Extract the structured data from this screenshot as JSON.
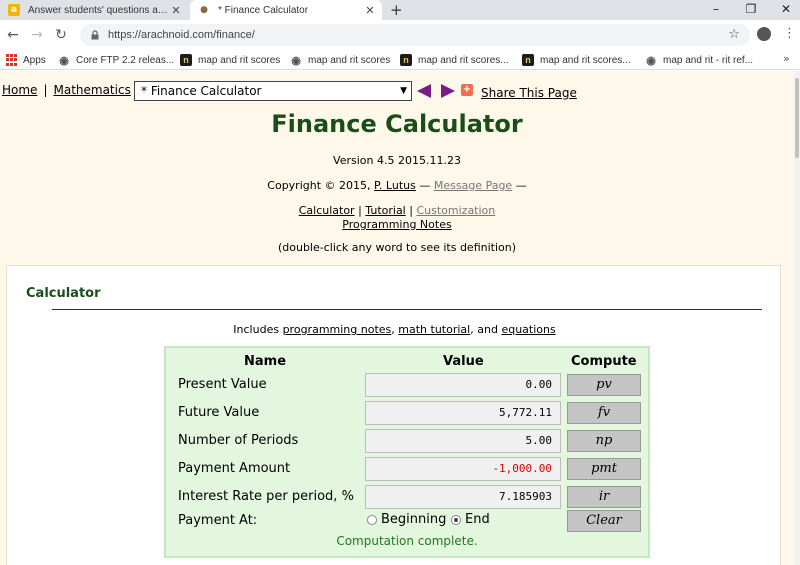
{
  "browser": {
    "tabs": [
      {
        "title": "Answer students' questions and"
      },
      {
        "title": "* Finance Calculator"
      }
    ],
    "new_tab": "+",
    "url": "https://arachnoid.com/finance/",
    "bookmarks": [
      {
        "label": "Apps"
      },
      {
        "label": "Core FTP 2.2 releas..."
      },
      {
        "label": "map and rit scores"
      },
      {
        "label": "map and rit scores"
      },
      {
        "label": "map and rit scores..."
      },
      {
        "label": "map and rit scores..."
      },
      {
        "label": "map and rit - rit ref..."
      }
    ]
  },
  "nav": {
    "home": "Home",
    "sep1": "|",
    "mathematics": "Mathematics",
    "sep2": "|",
    "select_value": "* Finance Calculator",
    "share": "Share This Page"
  },
  "header": {
    "title": "Finance Calculator",
    "version": "Version 4.5 2015.11.23",
    "copyright_pre": "Copyright © 2015,",
    "author": "P. Lutus",
    "dash1": "—",
    "message_page": "Message Page",
    "dash2": "—",
    "link_calculator": "Calculator",
    "link_sep1": "|",
    "link_tutorial": "Tutorial",
    "link_sep2": "|",
    "link_customization": "Customization",
    "link_programming": "Programming Notes",
    "hint": "(double-click any word to see its definition)"
  },
  "panel": {
    "title": "Calculator",
    "includes_pre": "Includes",
    "includes_link1": "programming notes",
    "includes_comma": ",",
    "includes_link2": "math tutorial",
    "includes_and": ", and",
    "includes_link3": "equations"
  },
  "calculator": {
    "col_name": "Name",
    "col_value": "Value",
    "col_compute": "Compute",
    "rows": [
      {
        "label": "Present Value",
        "value": "0.00",
        "button": "pv"
      },
      {
        "label": "Future Value",
        "value": "5,772.11",
        "button": "fv"
      },
      {
        "label": "Number of Periods",
        "value": "5.00",
        "button": "np"
      },
      {
        "label": "Payment Amount",
        "value": "-1,000.00",
        "button": "pmt"
      },
      {
        "label": "Interest Rate per period, %",
        "value": "7.185903",
        "button": "ir"
      }
    ],
    "payment_at_label": "Payment At:",
    "opt_beginning": "Beginning",
    "opt_end": "End",
    "clear": "Clear",
    "status": "Computation complete."
  },
  "colors": {
    "title_green": "#1a4d1a",
    "calc_bg": "#e3f7df",
    "negative": "#dd0000",
    "nav_arrow": "#7a1d84"
  }
}
